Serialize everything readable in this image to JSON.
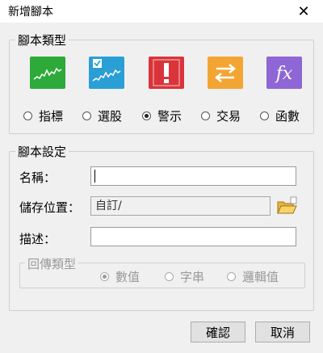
{
  "window": {
    "title": "新增腳本",
    "close_glyph": "✕"
  },
  "script_type": {
    "legend": "腳本類型",
    "icons": [
      {
        "name": "indicator-chart-icon",
        "color": "#2eaa3a"
      },
      {
        "name": "stock-select-chart-icon",
        "color": "#2a9fd6"
      },
      {
        "name": "alert-icon",
        "color": "#d9343a"
      },
      {
        "name": "trade-arrows-icon",
        "color": "#f3a533"
      },
      {
        "name": "function-icon",
        "color": "#8e66d6"
      }
    ],
    "options": [
      {
        "label": "指標",
        "selected": false
      },
      {
        "label": "選股",
        "selected": false
      },
      {
        "label": "警示",
        "selected": true
      },
      {
        "label": "交易",
        "selected": false
      },
      {
        "label": "函數",
        "selected": false
      }
    ]
  },
  "settings": {
    "legend": "腳本設定",
    "name_label": "名稱：",
    "name_value": "",
    "path_label": "儲存位置：",
    "path_value": "自訂/",
    "desc_label": "描述：",
    "desc_value": "",
    "return_type": {
      "legend": "回傳類型",
      "options": [
        {
          "label": "數值",
          "selected": true
        },
        {
          "label": "字串",
          "selected": false
        },
        {
          "label": "邏輯值",
          "selected": false
        }
      ]
    }
  },
  "buttons": {
    "ok": "確認",
    "cancel": "取消"
  }
}
